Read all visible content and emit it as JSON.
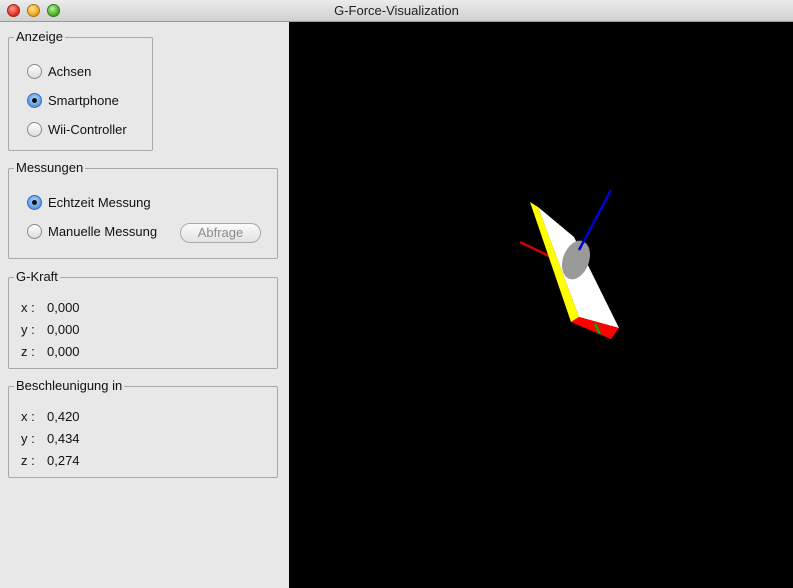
{
  "window": {
    "title": "G-Force-Visualization",
    "controls": [
      "close",
      "minimize",
      "zoom"
    ]
  },
  "anzeige": {
    "title": "Anzeige",
    "options": [
      {
        "label": "Achsen",
        "checked": false
      },
      {
        "label": "Smartphone",
        "checked": true
      },
      {
        "label": "Wii-Controller",
        "checked": false
      }
    ]
  },
  "messungen": {
    "title": "Messungen",
    "options": [
      {
        "label": "Echtzeit Messung",
        "checked": true
      },
      {
        "label": "Manuelle Messung",
        "checked": false
      }
    ],
    "query_button": "Abfrage",
    "query_button_enabled": false
  },
  "gkraft": {
    "title": "G-Kraft",
    "rows": [
      {
        "label": "x :",
        "value": "0,000"
      },
      {
        "label": "y :",
        "value": "0,000"
      },
      {
        "label": "z :",
        "value": "0,000"
      }
    ]
  },
  "beschleunigung": {
    "title": "Beschleunigung in",
    "rows": [
      {
        "label": "x :",
        "value": "0,420"
      },
      {
        "label": "y :",
        "value": "0,434"
      },
      {
        "label": "z :",
        "value": "0,274"
      }
    ]
  },
  "scene": {
    "background": "#000000",
    "object": "smartphone-model",
    "axis_colors": {
      "x": "#d00000",
      "y": "#00b000",
      "z": "#0000d0"
    },
    "face_colors": {
      "top": "#ffffff",
      "side": "#ffff00",
      "end": "#ff0000",
      "screen": "#9a9a9a"
    }
  }
}
